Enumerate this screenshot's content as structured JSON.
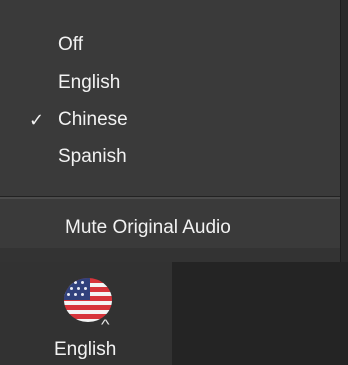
{
  "colors": {
    "menu_background": "#3a3a3a",
    "toolbar_background": "#242424",
    "button_background": "#323232",
    "text": "#f2f2f2"
  },
  "menu": {
    "items": [
      {
        "label": "Off",
        "checked": false
      },
      {
        "label": "English",
        "checked": false
      },
      {
        "label": "Chinese",
        "checked": true,
        "check_mark": "✓"
      },
      {
        "label": "Spanish",
        "checked": false
      }
    ],
    "mute_label": "Mute Original Audio"
  },
  "toolbar": {
    "language_button": {
      "icon": "us-flag-icon",
      "caret_icon": "caret-up-icon",
      "label": "English"
    }
  }
}
